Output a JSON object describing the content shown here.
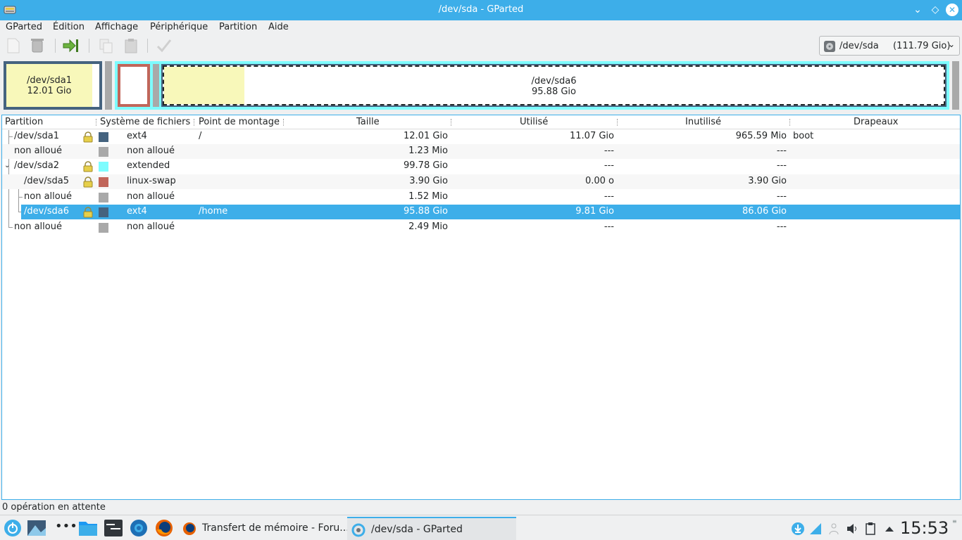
{
  "window": {
    "title": "/dev/sda - GParted",
    "icon": "gparted-icon",
    "buttons": [
      "minimize-icon",
      "maximize-icon",
      "close-icon"
    ]
  },
  "menu": {
    "items": [
      "GParted",
      "Édition",
      "Affichage",
      "Périphérique",
      "Partition",
      "Aide"
    ]
  },
  "toolbar": {
    "buttons": [
      "new-icon",
      "delete-icon",
      "resize-move-icon",
      "copy-icon",
      "paste-icon",
      "apply-icon"
    ],
    "device": "/dev/sda",
    "device_size": "(111.79 Gio)"
  },
  "diskmap": {
    "sda1_name": "/dev/sda1",
    "sda1_size": "12.01 Gio",
    "sda6_name": "/dev/sda6",
    "sda6_size": "95.88 Gio",
    "colors": {
      "ext4": "#45637f",
      "swap": "#c1665a",
      "extended": "#7dfcfe",
      "unallocated": "#a9a9a9",
      "used": "#f8f8ba",
      "selection": "#3daee9"
    }
  },
  "table": {
    "headers": {
      "partition": "Partition",
      "filesystem": "Système de fichiers",
      "mount": "Point de montage",
      "size": "Taille",
      "used": "Utilisé",
      "unused": "Inutilisé",
      "flags": "Drapeaux"
    },
    "rows": [
      {
        "partition": "/dev/sda1",
        "fs": "ext4",
        "mount": "/",
        "size": "12.01 Gio",
        "used": "11.07 Gio",
        "unused": "965.59 Mio",
        "flags": "boot"
      },
      {
        "partition": "non alloué",
        "fs": "non alloué",
        "mount": "",
        "size": "1.23 Mio",
        "used": "---",
        "unused": "---",
        "flags": ""
      },
      {
        "partition": "/dev/sda2",
        "fs": "extended",
        "mount": "",
        "size": "99.78 Gio",
        "used": "---",
        "unused": "---",
        "flags": ""
      },
      {
        "partition": "/dev/sda5",
        "fs": "linux-swap",
        "mount": "",
        "size": "3.90 Gio",
        "used": "0.00 o",
        "unused": "3.90 Gio",
        "flags": ""
      },
      {
        "partition": "non alloué",
        "fs": "non alloué",
        "mount": "",
        "size": "1.52 Mio",
        "used": "---",
        "unused": "---",
        "flags": ""
      },
      {
        "partition": "/dev/sda6",
        "fs": "ext4",
        "mount": "/home",
        "size": "95.88 Gio",
        "used": "9.81 Gio",
        "unused": "86.06 Gio",
        "flags": ""
      },
      {
        "partition": "non alloué",
        "fs": "non alloué",
        "mount": "",
        "size": "2.49 Mio",
        "used": "---",
        "unused": "---",
        "flags": ""
      }
    ]
  },
  "status": {
    "text": "0 opération en attente"
  },
  "taskbar": {
    "tasks": [
      {
        "label": "Transfert de mémoire - Foru...",
        "icon": "firefox-icon"
      },
      {
        "label": "/dev/sda - GParted",
        "icon": "gparted-icon"
      }
    ],
    "clock": "15:53"
  }
}
